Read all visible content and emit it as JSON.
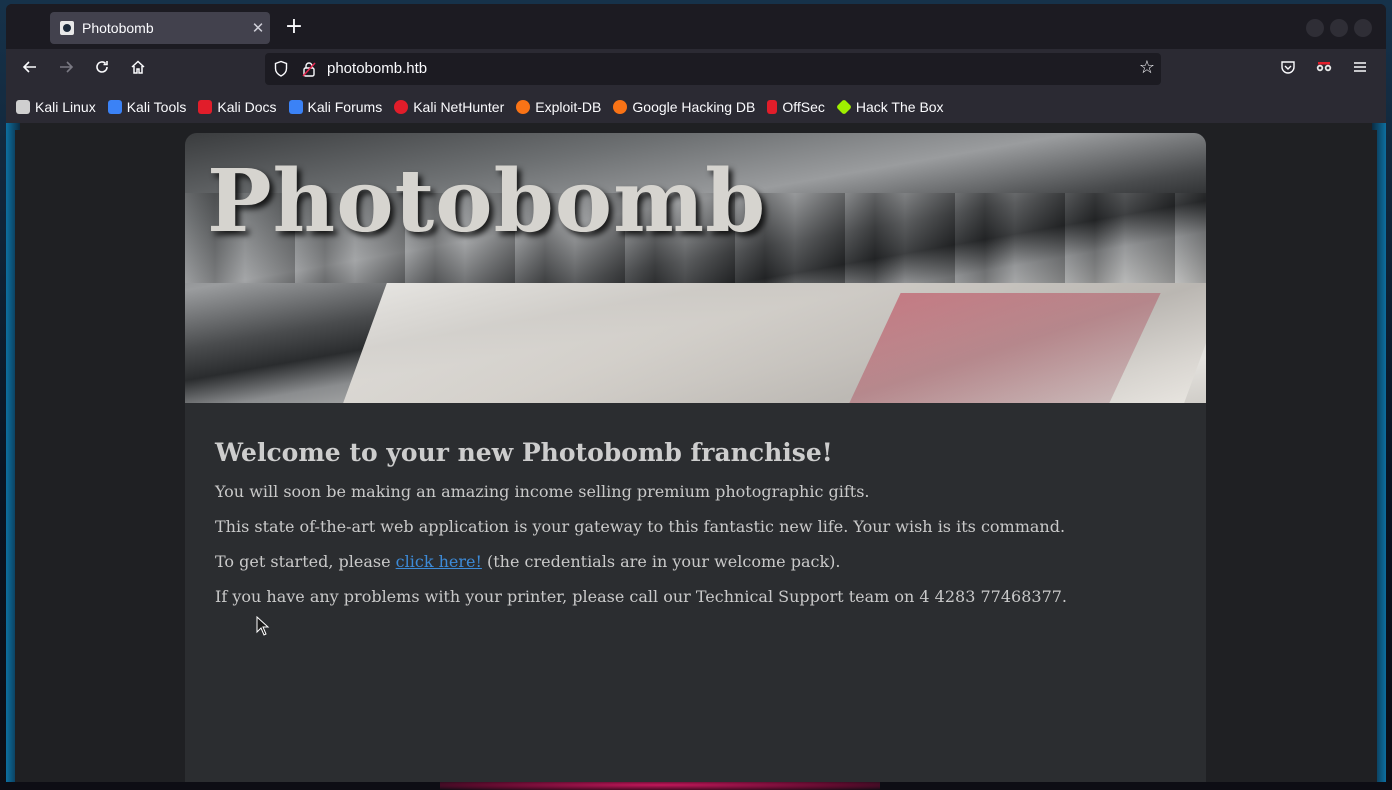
{
  "browser": {
    "tab_title": "Photobomb",
    "url": "photobomb.htb",
    "bookmarks": [
      {
        "label": "Kali Linux",
        "icon": "kali-dragon-icon",
        "color": "#cfcfcf"
      },
      {
        "label": "Kali Tools",
        "icon": "kali-tools-icon",
        "color": "#3b82f6"
      },
      {
        "label": "Kali Docs",
        "icon": "kali-docs-icon",
        "color": "#e11d2a"
      },
      {
        "label": "Kali Forums",
        "icon": "kali-forums-icon",
        "color": "#3b82f6"
      },
      {
        "label": "Kali NetHunter",
        "icon": "kali-nethunter-icon",
        "color": "#e11d2a"
      },
      {
        "label": "Exploit-DB",
        "icon": "exploit-db-icon",
        "color": "#f97316"
      },
      {
        "label": "Google Hacking DB",
        "icon": "ghdb-icon",
        "color": "#f97316"
      },
      {
        "label": "OffSec",
        "icon": "offsec-icon",
        "color": "#e11d2a"
      },
      {
        "label": "Hack The Box",
        "icon": "htb-icon",
        "color": "#9fef00"
      }
    ]
  },
  "page": {
    "hero_title": "Photobomb",
    "heading": "Welcome to your new Photobomb franchise!",
    "para1": "You will soon be making an amazing income selling premium photographic gifts.",
    "para2": "This state of-the-art web application is your gateway to this fantastic new life. Your wish is its command.",
    "para3_before": "To get started, please ",
    "para3_link": "click here!",
    "para3_after": " (the credentials are in your welcome pack).",
    "para4": "If you have any problems with your printer, please call our Technical Support team on 4 4283 77468377."
  }
}
